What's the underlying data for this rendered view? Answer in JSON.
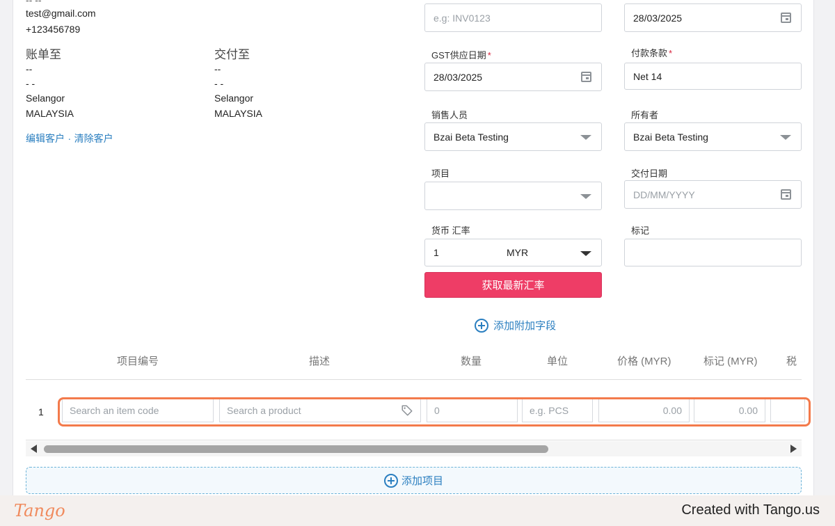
{
  "customer": {
    "partial_top": "-- --",
    "email": "test@gmail.com",
    "phone": "+123456789",
    "bill_to": {
      "heading": "账单至",
      "line1": "--",
      "line2": "- -",
      "state": "Selangor",
      "country": "MALAYSIA"
    },
    "ship_to": {
      "heading": "交付至",
      "line1": "--",
      "line2": "- -",
      "state": "Selangor",
      "country": "MALAYSIA"
    },
    "edit_link": "编辑客户",
    "separator": "·",
    "clear_link": "清除客户"
  },
  "form": {
    "invoice_no_placeholder": "e.g: INV0123",
    "invoice_date": "28/03/2025",
    "gst_supply_date_label": "GST供应日期",
    "gst_supply_date": "28/03/2025",
    "payment_terms_label": "付款条款",
    "payment_terms": "Net 14",
    "salesperson_label": "销售人员",
    "salesperson": "Bzai Beta Testing",
    "owner_label": "所有者",
    "owner": "Bzai Beta Testing",
    "project_label": "项目",
    "project": "",
    "delivery_date_label": "交付日期",
    "delivery_date_placeholder": "DD/MM/YYYY",
    "currency_rate_label": "货币 汇率",
    "rate": "1",
    "currency": "MYR",
    "tag_label": "标记",
    "tag": "",
    "required_mark": "*",
    "get_rate_button": "获取最新汇率",
    "add_field_link": "添加附加字段"
  },
  "items_table": {
    "columns": {
      "item_code": "项目编号",
      "description": "描述",
      "quantity": "数量",
      "unit": "单位",
      "price": "价格 (MYR)",
      "tag": "标记 (MYR)",
      "tax": "税"
    },
    "row": {
      "index": "1",
      "item_code_placeholder": "Search an item code",
      "product_placeholder": "Search a product",
      "quantity_placeholder": "0",
      "unit_placeholder": "e.g. PCS",
      "price_placeholder": "0.00",
      "tag_placeholder": "0.00"
    },
    "add_item": "添加项目"
  },
  "footer": {
    "logo": "Tango",
    "created_with": "Created with Tango.us"
  },
  "colors": {
    "accent_red": "#ee3d66",
    "link_blue": "#2b7fc0",
    "highlight_orange": "#f37a4b",
    "tango_orange": "#f08a5d"
  }
}
